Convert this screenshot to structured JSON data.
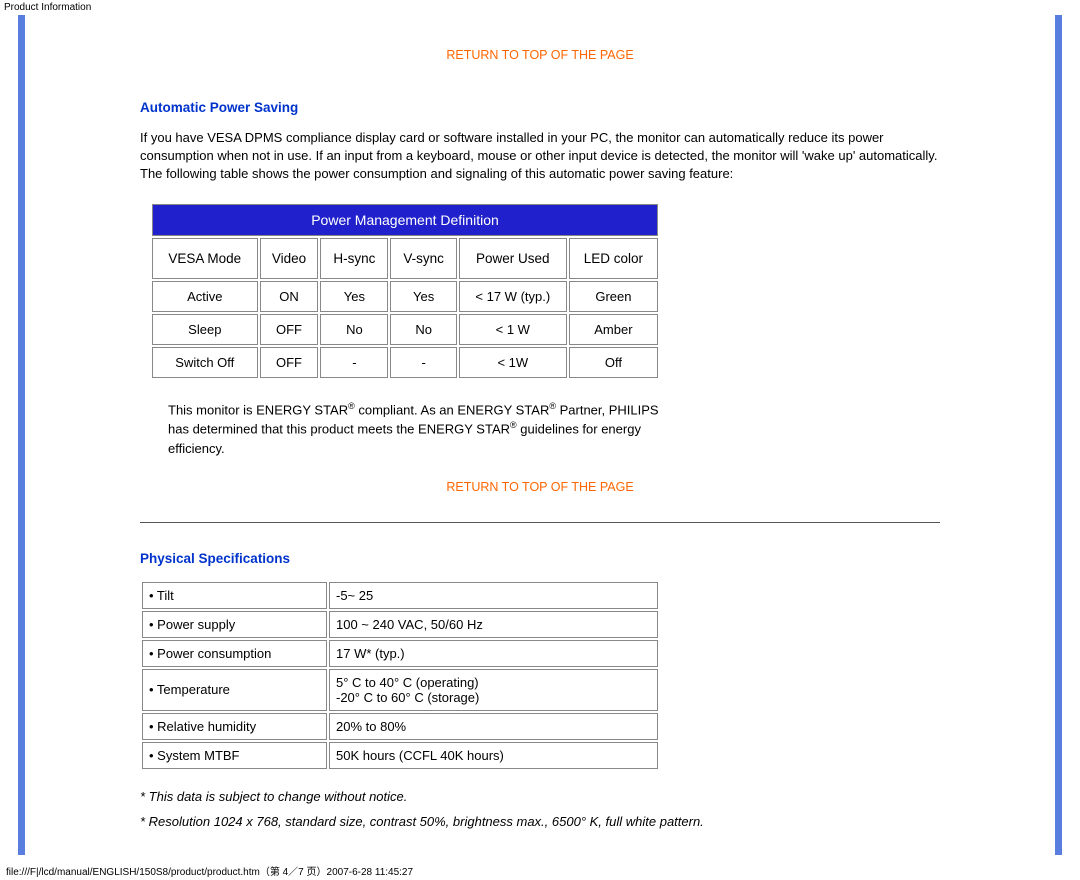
{
  "header_label": "Product Information",
  "return_link": "RETURN TO TOP OF THE PAGE",
  "section_power": {
    "heading": "Automatic Power Saving",
    "intro": "If you have VESA DPMS compliance display card or software installed in your PC, the monitor can automatically reduce its power consumption when not in use. If an input from a keyboard, mouse or other input device is detected, the monitor will 'wake up' automatically. The following table shows the power consumption and signaling of this automatic power saving feature:",
    "table_title": "Power Management Definition",
    "cols": [
      "VESA Mode",
      "Video",
      "H-sync",
      "V-sync",
      "Power Used",
      "LED color"
    ],
    "rows": [
      [
        "Active",
        "ON",
        "Yes",
        "Yes",
        "< 17 W (typ.)",
        "Green"
      ],
      [
        "Sleep",
        "OFF",
        "No",
        "No",
        "< 1 W",
        "Amber"
      ],
      [
        "Switch Off",
        "OFF",
        "-",
        "-",
        "< 1W",
        "Off"
      ]
    ],
    "energy_note_pre": "This monitor is ENERGY STAR",
    "energy_note_mid": " compliant. As an ENERGY STAR",
    "energy_note_mid2": " Partner, PHILIPS has determined that this product meets the ENERGY STAR",
    "energy_note_end": " guidelines for energy efficiency.",
    "reg": "®"
  },
  "section_phys": {
    "heading": "Physical Specifications",
    "rows": [
      {
        "label": "• Tilt",
        "value": "-5~ 25"
      },
      {
        "label": "• Power supply",
        "value": "100 ~ 240 VAC, 50/60 Hz"
      },
      {
        "label": "• Power consumption",
        "value": "17 W* (typ.)"
      },
      {
        "label": "• Temperature",
        "value": "5° C to 40° C (operating)\n-20° C to 60° C (storage)"
      },
      {
        "label": "• Relative humidity",
        "value": "20% to 80%"
      },
      {
        "label": "• System MTBF",
        "value": "50K hours (CCFL 40K hours)"
      }
    ],
    "footnote1": "* This data is subject to change without notice.",
    "footnote2": "* Resolution 1024 x 768, standard size, contrast 50%, brightness max., 6500° K, full white pattern."
  },
  "chart_data": {
    "type": "table",
    "title": "Power Management Definition",
    "columns": [
      "VESA Mode",
      "Video",
      "H-sync",
      "V-sync",
      "Power Used",
      "LED color"
    ],
    "rows": [
      [
        "Active",
        "ON",
        "Yes",
        "Yes",
        "< 17 W (typ.)",
        "Green"
      ],
      [
        "Sleep",
        "OFF",
        "No",
        "No",
        "< 1 W",
        "Amber"
      ],
      [
        "Switch Off",
        "OFF",
        "-",
        "-",
        "< 1W",
        "Off"
      ]
    ]
  },
  "footer": "file:///F|/lcd/manual/ENGLISH/150S8/product/product.htm（第 4／7 页）2007-6-28 11:45:27"
}
